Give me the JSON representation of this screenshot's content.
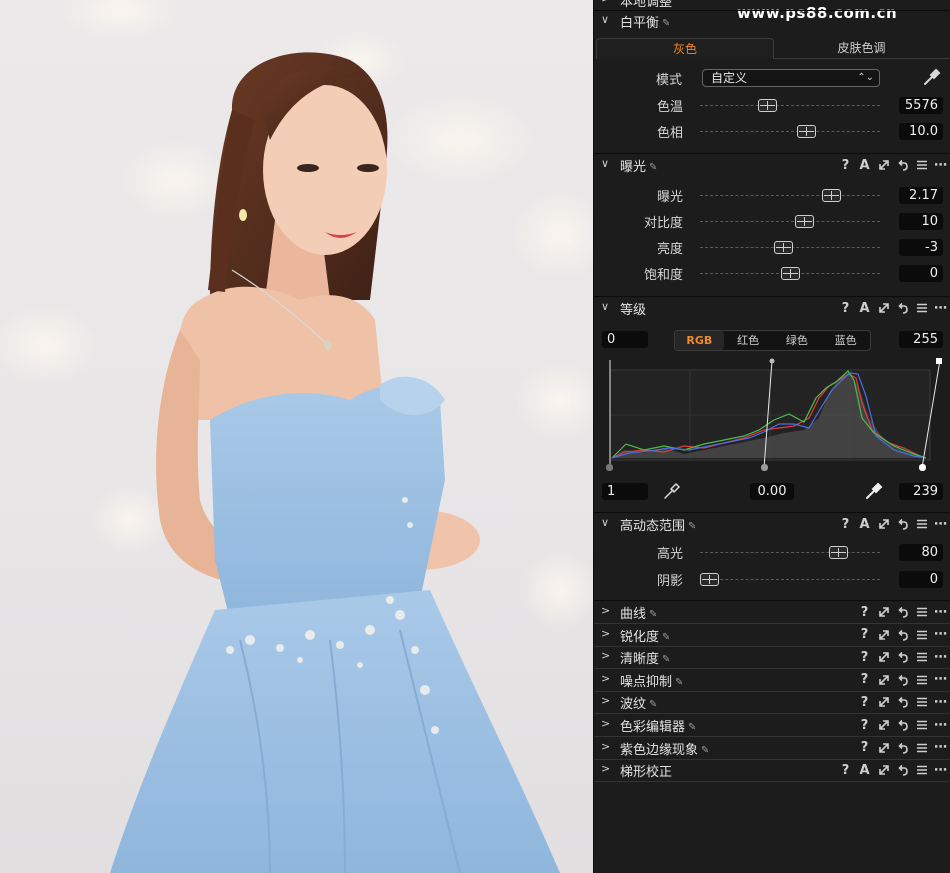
{
  "watermark": "www.ps88.com.cn",
  "sections": {
    "local_adjust": {
      "title": "本地调整"
    },
    "white_balance": {
      "title": "白平衡",
      "tabs": [
        "灰色",
        "皮肤色调"
      ],
      "mode_label": "模式",
      "mode_value": "自定义",
      "sliders": [
        {
          "label": "色温",
          "value": "5576",
          "pos": 0.36
        },
        {
          "label": "色相",
          "value": "10.0",
          "pos": 0.6
        }
      ]
    },
    "exposure": {
      "title": "曝光",
      "sliders": [
        {
          "label": "曝光",
          "value": "2.17",
          "pos": 0.76
        },
        {
          "label": "对比度",
          "value": "10",
          "pos": 0.59
        },
        {
          "label": "亮度",
          "value": "-3",
          "pos": 0.46
        },
        {
          "label": "饱和度",
          "value": "0",
          "pos": 0.5
        }
      ]
    },
    "levels": {
      "title": "等级",
      "input_low": "0",
      "input_high": "255",
      "channels": [
        "RGB",
        "红色",
        "绿色",
        "蓝色"
      ],
      "active_channel": "RGB",
      "output_low": "1",
      "midtone": "0.00",
      "output_high": "239"
    },
    "hdr": {
      "title": "高动态范围",
      "sliders": [
        {
          "label": "高光",
          "value": "80",
          "pos": 0.8
        },
        {
          "label": "阴影",
          "value": "0",
          "pos": 0.0
        }
      ]
    },
    "collapsed": [
      {
        "title": "曲线",
        "pen": true,
        "has_a": false
      },
      {
        "title": "锐化度",
        "pen": true,
        "has_a": false
      },
      {
        "title": "清晰度",
        "pen": true,
        "has_a": false
      },
      {
        "title": "噪点抑制",
        "pen": true,
        "has_a": false
      },
      {
        "title": "波纹",
        "pen": true,
        "has_a": false
      },
      {
        "title": "色彩编辑器",
        "pen": true,
        "has_a": false
      },
      {
        "title": "紫色边缘现象",
        "pen": true,
        "has_a": false
      },
      {
        "title": "梯形校正",
        "pen": false,
        "has_a": true
      }
    ]
  },
  "tool_icons": [
    "help-icon",
    "auto-icon",
    "expand-icon",
    "reset-icon",
    "list-icon",
    "more-icon"
  ],
  "colors": {
    "accent": "#f0892a",
    "panel_bg": "#1c1c1c",
    "value_bg": "#0b0b0b"
  }
}
